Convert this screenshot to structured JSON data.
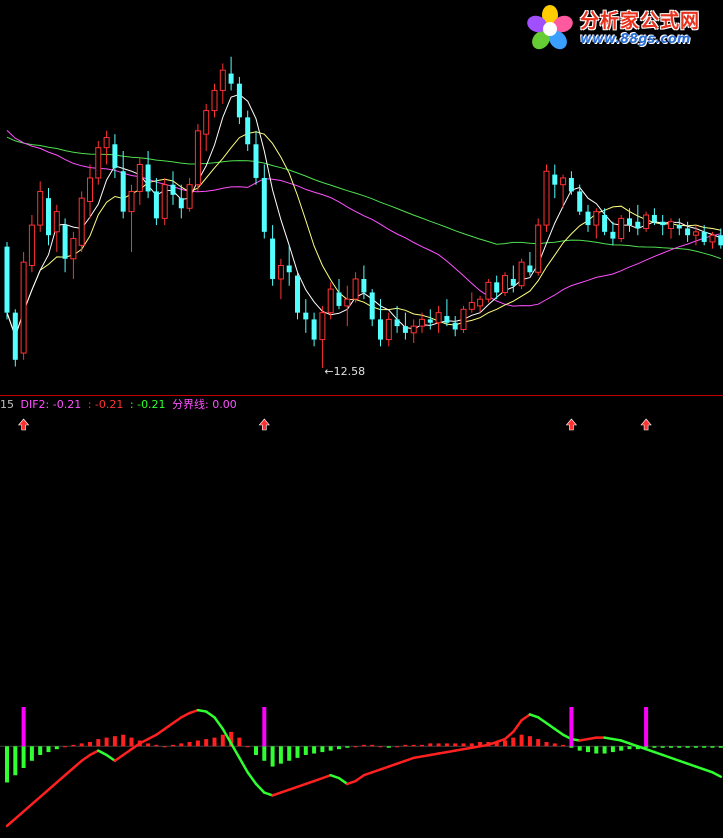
{
  "watermark": {
    "title": "分析家公式网",
    "url": "www.88gs.com"
  },
  "legend": {
    "period": "15",
    "dif_label": "DIF2: -0.21",
    "item2_label": ": -0.21",
    "item3_label": ": -0.21",
    "zero_label": "分界线: 0.00"
  },
  "colors": {
    "up": "#ff3232",
    "down": "#54ffff",
    "ma5": "#ffffff",
    "ma10": "#ffff80",
    "ma30": "#ff50ff",
    "ma60": "#50e050",
    "separator": "#c00000",
    "magenta": "#ff00ff",
    "hist_pos": "#ff2020",
    "hist_neg": "#30ff30"
  },
  "chart_data": [
    {
      "type": "candlestick",
      "low_annotation": {
        "text": "12.58",
        "value": 12.58
      },
      "candles": [
        [
          14.38,
          14.45,
          13.3,
          13.4
        ],
        [
          13.4,
          13.45,
          12.6,
          12.7
        ],
        [
          12.8,
          14.3,
          12.7,
          14.15
        ],
        [
          14.1,
          14.85,
          14.0,
          14.7
        ],
        [
          14.7,
          15.35,
          14.6,
          15.2
        ],
        [
          15.1,
          15.25,
          14.4,
          14.55
        ],
        [
          14.6,
          15.0,
          14.3,
          14.9
        ],
        [
          14.7,
          14.8,
          14.0,
          14.2
        ],
        [
          14.2,
          14.6,
          13.9,
          14.5
        ],
        [
          14.4,
          15.2,
          14.3,
          15.1
        ],
        [
          15.05,
          15.6,
          14.8,
          15.4
        ],
        [
          15.4,
          15.95,
          15.3,
          15.85
        ],
        [
          15.85,
          16.1,
          15.6,
          16.0
        ],
        [
          15.9,
          16.05,
          15.4,
          15.55
        ],
        [
          15.5,
          15.8,
          14.8,
          14.9
        ],
        [
          14.9,
          15.3,
          14.3,
          15.2
        ],
        [
          15.2,
          15.7,
          15.0,
          15.6
        ],
        [
          15.6,
          15.8,
          15.1,
          15.2
        ],
        [
          15.2,
          15.4,
          14.7,
          14.8
        ],
        [
          14.8,
          15.4,
          14.7,
          15.3
        ],
        [
          15.3,
          15.5,
          15.0,
          15.15
        ],
        [
          15.1,
          15.3,
          14.8,
          14.95
        ],
        [
          14.95,
          15.4,
          14.9,
          15.3
        ],
        [
          15.3,
          16.2,
          15.2,
          16.1
        ],
        [
          16.05,
          16.5,
          15.8,
          16.4
        ],
        [
          16.4,
          16.8,
          16.3,
          16.7
        ],
        [
          16.7,
          17.1,
          16.5,
          17.0
        ],
        [
          16.95,
          17.2,
          16.7,
          16.8
        ],
        [
          16.8,
          16.9,
          16.2,
          16.3
        ],
        [
          16.3,
          16.4,
          15.8,
          15.9
        ],
        [
          15.9,
          16.1,
          15.3,
          15.4
        ],
        [
          15.4,
          15.6,
          14.5,
          14.6
        ],
        [
          14.5,
          14.7,
          13.8,
          13.9
        ],
        [
          13.9,
          14.2,
          13.6,
          14.1
        ],
        [
          14.1,
          14.4,
          13.8,
          14.0
        ],
        [
          13.95,
          14.0,
          13.3,
          13.4
        ],
        [
          13.4,
          13.6,
          13.1,
          13.3
        ],
        [
          13.3,
          13.4,
          12.9,
          13.0
        ],
        [
          13.0,
          13.5,
          12.58,
          13.4
        ],
        [
          13.4,
          13.85,
          13.3,
          13.75
        ],
        [
          13.7,
          13.9,
          13.45,
          13.5
        ],
        [
          13.5,
          13.8,
          13.2,
          13.6
        ],
        [
          13.6,
          14.0,
          13.55,
          13.9
        ],
        [
          13.9,
          14.1,
          13.6,
          13.7
        ],
        [
          13.7,
          13.75,
          13.2,
          13.3
        ],
        [
          13.3,
          13.6,
          12.9,
          13.0
        ],
        [
          13.0,
          13.4,
          12.9,
          13.3
        ],
        [
          13.3,
          13.5,
          13.1,
          13.2
        ],
        [
          13.2,
          13.4,
          13.0,
          13.1
        ],
        [
          13.1,
          13.3,
          12.95,
          13.2
        ],
        [
          13.2,
          13.4,
          13.1,
          13.3
        ],
        [
          13.3,
          13.45,
          13.15,
          13.25
        ],
        [
          13.25,
          13.5,
          13.1,
          13.4
        ],
        [
          13.35,
          13.6,
          13.2,
          13.25
        ],
        [
          13.25,
          13.35,
          13.05,
          13.15
        ],
        [
          13.15,
          13.5,
          13.1,
          13.45
        ],
        [
          13.45,
          13.7,
          13.4,
          13.55
        ],
        [
          13.5,
          13.65,
          13.4,
          13.6
        ],
        [
          13.6,
          13.9,
          13.55,
          13.85
        ],
        [
          13.85,
          13.95,
          13.6,
          13.7
        ],
        [
          13.7,
          14.0,
          13.65,
          13.95
        ],
        [
          13.9,
          14.1,
          13.7,
          13.8
        ],
        [
          13.8,
          14.2,
          13.75,
          14.15
        ],
        [
          14.1,
          14.3,
          13.95,
          14.0
        ],
        [
          14.0,
          14.8,
          13.95,
          14.7
        ],
        [
          14.7,
          15.6,
          14.6,
          15.5
        ],
        [
          15.45,
          15.6,
          15.1,
          15.3
        ],
        [
          15.3,
          15.45,
          14.95,
          15.4
        ],
        [
          15.4,
          15.5,
          15.15,
          15.2
        ],
        [
          15.2,
          15.3,
          14.85,
          14.9
        ],
        [
          14.9,
          15.0,
          14.6,
          14.7
        ],
        [
          14.7,
          14.95,
          14.5,
          14.9
        ],
        [
          14.85,
          14.95,
          14.55,
          14.6
        ],
        [
          14.6,
          14.75,
          14.4,
          14.5
        ],
        [
          14.5,
          14.85,
          14.45,
          14.8
        ],
        [
          14.8,
          14.95,
          14.6,
          14.7
        ],
        [
          14.75,
          15.0,
          14.55,
          14.65
        ],
        [
          14.65,
          14.9,
          14.6,
          14.85
        ],
        [
          14.85,
          14.95,
          14.7,
          14.75
        ],
        [
          14.75,
          14.85,
          14.55,
          14.7
        ],
        [
          14.65,
          14.8,
          14.5,
          14.75
        ],
        [
          14.7,
          14.8,
          14.55,
          14.65
        ],
        [
          14.65,
          14.75,
          14.45,
          14.55
        ],
        [
          14.55,
          14.7,
          14.4,
          14.6
        ],
        [
          14.6,
          14.7,
          14.4,
          14.45
        ],
        [
          14.45,
          14.6,
          14.35,
          14.55
        ],
        [
          14.55,
          14.65,
          14.35,
          14.4
        ]
      ],
      "moving_averages": [
        {
          "period": 5,
          "color_key": "ma5"
        },
        {
          "period": 10,
          "color_key": "ma10"
        },
        {
          "period": 30,
          "color_key": "ma30"
        },
        {
          "period": 60,
          "color_key": "ma60"
        }
      ]
    },
    {
      "type": "bar",
      "title": "DIF2",
      "signal_bars": [
        2,
        31,
        68,
        77
      ],
      "separator_value": 0.0,
      "last_value": -0.21,
      "series": [
        {
          "line": "dif",
          "values": [
            -0.55,
            -0.5,
            -0.45,
            -0.4,
            -0.35,
            -0.3,
            -0.25,
            -0.2,
            -0.15,
            -0.1,
            -0.06,
            -0.03,
            -0.06,
            -0.1,
            -0.06,
            -0.02,
            0.02,
            0.05,
            0.08,
            0.12,
            0.16,
            0.2,
            0.23,
            0.25,
            0.24,
            0.2,
            0.12,
            0.02,
            -0.08,
            -0.18,
            -0.26,
            -0.32,
            -0.34,
            -0.32,
            -0.3,
            -0.28,
            -0.26,
            -0.24,
            -0.22,
            -0.2,
            -0.22,
            -0.26,
            -0.24,
            -0.2,
            -0.18,
            -0.16,
            -0.14,
            -0.12,
            -0.1,
            -0.08,
            -0.07,
            -0.06,
            -0.05,
            -0.04,
            -0.03,
            -0.02,
            -0.01,
            0.0,
            0.01,
            0.03,
            0.05,
            0.1,
            0.18,
            0.22,
            0.2,
            0.16,
            0.12,
            0.08,
            0.05,
            0.04,
            0.05,
            0.06,
            0.06,
            0.05,
            0.04,
            0.02,
            0.0,
            -0.02,
            -0.04,
            -0.06,
            -0.08,
            -0.1,
            -0.12,
            -0.14,
            -0.16,
            -0.18,
            -0.21
          ]
        },
        {
          "line": "histogram",
          "values": [
            -0.25,
            -0.2,
            -0.15,
            -0.1,
            -0.06,
            -0.04,
            -0.02,
            0.0,
            0.01,
            0.02,
            0.03,
            0.05,
            0.06,
            0.07,
            0.08,
            0.06,
            0.04,
            0.02,
            0.01,
            0.0,
            0.01,
            0.02,
            0.03,
            0.04,
            0.05,
            0.06,
            0.08,
            0.1,
            0.06,
            0.0,
            -0.06,
            -0.1,
            -0.14,
            -0.12,
            -0.1,
            -0.08,
            -0.06,
            -0.05,
            -0.04,
            -0.03,
            -0.02,
            -0.01,
            0.0,
            0.01,
            0.01,
            0.0,
            -0.01,
            0.0,
            0.01,
            0.01,
            0.01,
            0.02,
            0.02,
            0.02,
            0.02,
            0.02,
            0.02,
            0.03,
            0.03,
            0.03,
            0.04,
            0.06,
            0.08,
            0.07,
            0.05,
            0.03,
            0.02,
            0.01,
            -0.01,
            -0.03,
            -0.04,
            -0.05,
            -0.05,
            -0.04,
            -0.03,
            -0.02,
            -0.02,
            -0.01,
            -0.01,
            -0.01,
            -0.01,
            -0.01,
            -0.01,
            -0.01,
            -0.01,
            -0.01,
            -0.01
          ]
        }
      ]
    }
  ]
}
